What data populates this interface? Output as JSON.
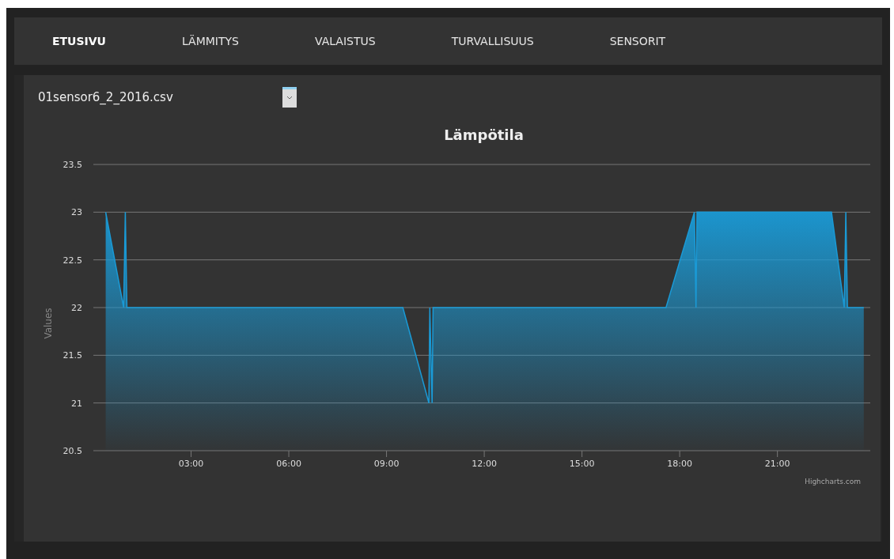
{
  "nav": {
    "tabs": [
      {
        "label": "ETUSIVU",
        "selected": true
      },
      {
        "label": "LÄMMITYS",
        "selected": false
      },
      {
        "label": "VALAISTUS",
        "selected": false
      },
      {
        "label": "TURVALLISUUS",
        "selected": false
      },
      {
        "label": "SENSORIT",
        "selected": false
      }
    ]
  },
  "file_select": {
    "value": "01sensor6_2_2016.csv"
  },
  "chart": {
    "credit": "Highcharts.com",
    "chart_data": {
      "type": "area",
      "title": "Lämpötila",
      "ylabel": "Values",
      "x": [
        0.38,
        0.93,
        0.98,
        1.03,
        9.5,
        10.3,
        10.33,
        10.4,
        10.43,
        17.58,
        18.45,
        18.5,
        18.53,
        22.66,
        23.05,
        23.1,
        23.15,
        23.65
      ],
      "grid": true,
      "series": [
        {
          "color": "#1a9ad6",
          "values": [
            23,
            22,
            23,
            22,
            22,
            21,
            22,
            21,
            22,
            22,
            23,
            22,
            23,
            23,
            22,
            23,
            22,
            22
          ]
        }
      ],
      "xlim": [
        0,
        23.85
      ],
      "ylim": [
        20.5,
        23.5
      ],
      "xticks": [
        {
          "value": 3,
          "label": "03:00"
        },
        {
          "value": 6,
          "label": "06:00"
        },
        {
          "value": 9,
          "label": "09:00"
        },
        {
          "value": 12,
          "label": "12:00"
        },
        {
          "value": 15,
          "label": "15:00"
        },
        {
          "value": 18,
          "label": "18:00"
        },
        {
          "value": 21,
          "label": "21:00"
        }
      ],
      "yticks": [
        20.5,
        21,
        21.5,
        22,
        22.5,
        23,
        23.5
      ]
    }
  }
}
